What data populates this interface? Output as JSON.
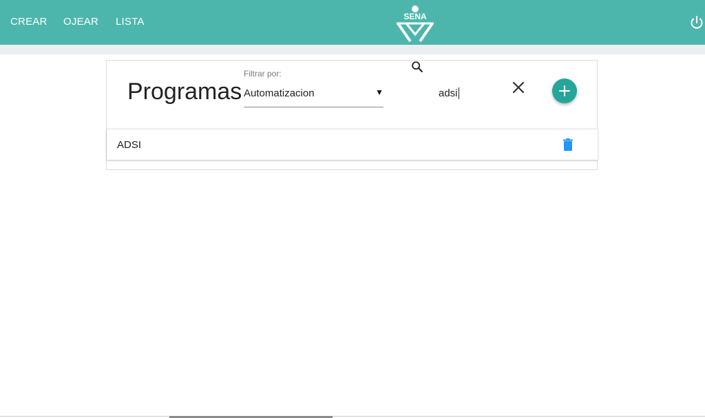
{
  "nav": {
    "items": [
      {
        "label": "CREAR"
      },
      {
        "label": "OJEAR"
      },
      {
        "label": "LISTA"
      }
    ],
    "logo_text": "SENA"
  },
  "card": {
    "title": "Programas",
    "filter": {
      "label": "Filtrar por:",
      "selected": "Automatizacion"
    },
    "search": {
      "value": "adsi"
    },
    "list": [
      {
        "label": "ADSI"
      }
    ]
  },
  "colors": {
    "topbar": "#4db6ac",
    "add_button": "#26a69a",
    "trash": "#2196f3"
  }
}
